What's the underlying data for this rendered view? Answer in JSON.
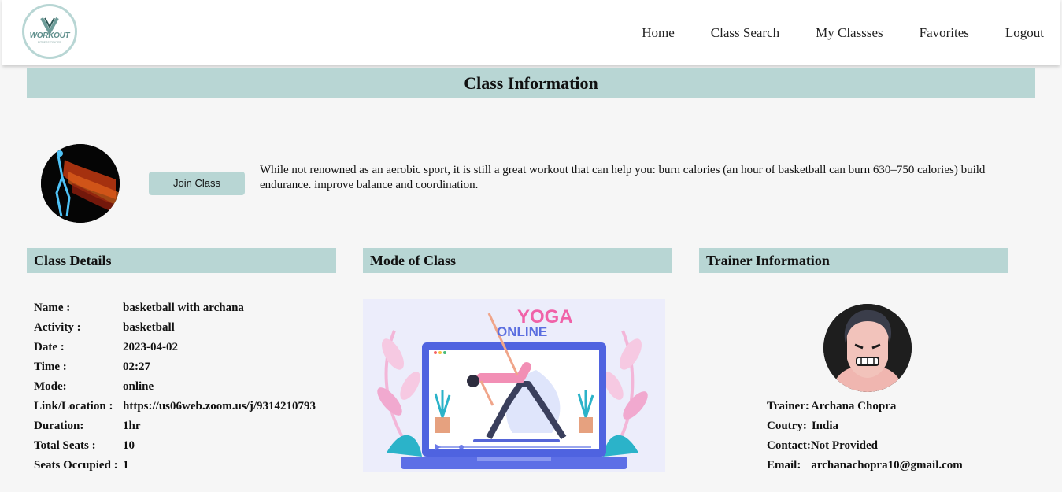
{
  "nav": {
    "logo_text": "WORKOUT",
    "logo_sub": "FITNESS CENTER",
    "items": [
      "Home",
      "Class Search",
      "My Classses",
      "Favorites",
      "Logout"
    ]
  },
  "page_title": "Class Information",
  "join_button": "Join Class",
  "description": "While not renowned as an aerobic sport, it is still a great workout that can help you: burn calories (an hour of basketball can burn 630–750 calories) build endurance. improve balance and coordination.",
  "sections": {
    "details": "Class Details",
    "mode": "Mode of Class",
    "trainer": "Trainer Information"
  },
  "class_details": [
    {
      "label": "Name :",
      "value": "basketball with archana"
    },
    {
      "label": "Activity :",
      "value": "basketball"
    },
    {
      "label": "Date :",
      "value": "2023-04-02"
    },
    {
      "label": "Time :",
      "value": "02:27"
    },
    {
      "label": "Mode:",
      "value": "online"
    },
    {
      "label": "Link/Location :",
      "value": "https://us06web.zoom.us/j/9314210793"
    },
    {
      "label": "Duration:",
      "value": "1hr"
    },
    {
      "label": "Total Seats :",
      "value": "10"
    },
    {
      "label": "Seats Occupied :",
      "value": "1"
    }
  ],
  "mode_image": {
    "title": "YOGA",
    "subtitle": "ONLINE"
  },
  "trainer": [
    {
      "label": "Trainer:",
      "value": "Archana Chopra"
    },
    {
      "label": "Coutry:",
      "value": "India"
    },
    {
      "label": "Contact:",
      "value": "Not Provided"
    },
    {
      "label": "Email:",
      "value": "archanachopra10@gmail.com"
    }
  ],
  "colors": {
    "accent": "#b8d6d4",
    "background": "#f6f6f6"
  }
}
